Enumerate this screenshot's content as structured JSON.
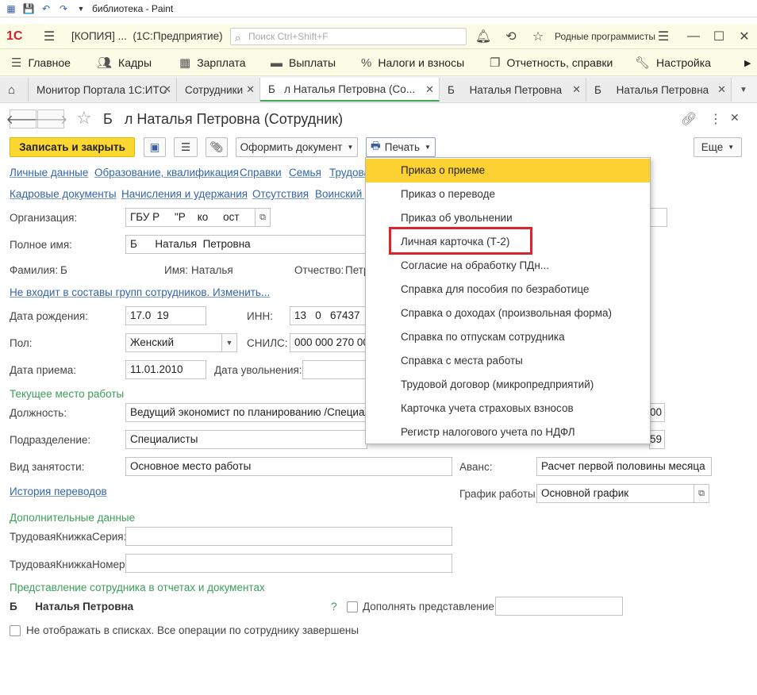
{
  "paint": {
    "title": "библиотека - Paint"
  },
  "top_bar": {
    "app_title": "[КОПИЯ] ...  (1С:Предприятие)",
    "search_placeholder": "Поиск Ctrl+Shift+F",
    "user": "Родные программисты"
  },
  "main_menu": {
    "items": [
      {
        "label": "Главное",
        "icon": "menu-icon"
      },
      {
        "label": "Кадры",
        "icon": "people-icon"
      },
      {
        "label": "Зарплата",
        "icon": "calculator-icon"
      },
      {
        "label": "Выплаты",
        "icon": "wallet-icon"
      },
      {
        "label": "Налоги и взносы",
        "icon": "percent-icon"
      },
      {
        "label": "Отчетность, справки",
        "icon": "report-icon"
      },
      {
        "label": "Настройка",
        "icon": "wrench-icon"
      }
    ]
  },
  "tabs": [
    {
      "label": "Монитор Портала 1С:ИТС"
    },
    {
      "label": "Сотрудники"
    },
    {
      "label": "Б   л Наталья Петровна (Со..."
    },
    {
      "label": "Б     Наталья Петровна"
    },
    {
      "label": "Б     Наталья Петровна"
    }
  ],
  "form": {
    "title": "Б   л Наталья Петровна (Сотрудник)",
    "toolbar": {
      "save_close": "Записать и закрыть",
      "create_doc": "Оформить документ",
      "print": "Печать",
      "more": "Еще"
    },
    "links_row1": [
      "Личные данные",
      "Образование, квалификация",
      "Справки",
      "Семья",
      "Трудова"
    ],
    "links_row2": [
      "Кадровые документы",
      "Начисления и удержания",
      "Отсутствия",
      "Воинский у"
    ],
    "labels": {
      "org": "Организация:",
      "fullname": "Полное имя:",
      "surname": "Фамилия:",
      "name": "Имя:",
      "patronymic": "Отчество:",
      "groups_link": "Не входит в составы групп сотрудников. Изменить...",
      "birth": "Дата рождения:",
      "inn": "ИНН:",
      "sex": "Пол:",
      "snils": "СНИЛС:",
      "hire": "Дата приема:",
      "fire": "Дата увольнения:",
      "current_work": "Текущее место работы",
      "position": "Должность:",
      "department": "Подразделение:",
      "employment": "Вид занятости:",
      "advance": "Аванс:",
      "history_link": "История переводов",
      "schedule": "График работы:",
      "extra": "Дополнительные данные",
      "book_series": "ТрудоваяКнижкаСерия:",
      "book_number": "ТрудоваяКнижкаНомер:",
      "representation": "Представление сотрудника в отчетах и документах",
      "complement": "Дополнять представление",
      "hide": "Не отображать в списках. Все операции по сотруднику завершены",
      "help": "?"
    },
    "values": {
      "org": "ГБУ Р     \"Р    ко     ост",
      "fullname": "Б      Наталья  Петровна",
      "surname": "Б",
      "name": "Наталья",
      "patronymic": "Петр",
      "birth": "17.0  19",
      "inn": "13   0   67437",
      "sex": "Женский",
      "snils": "000 000 270 00",
      "hire": "11.01.2010",
      "position": "Ведущий экономист по планированию /Специали",
      "department": "Специалисты",
      "employment": "Основное место работы",
      "advance": "Расчет первой половины месяца",
      "schedule": "Основной график",
      "right1": "00",
      "right2": "59",
      "rep_name": "Б      Наталья Петровна"
    }
  },
  "print_menu": {
    "items": [
      "Приказ о приеме",
      "Приказ о переводе",
      "Приказ об увольнении",
      "Личная карточка (Т-2)",
      "Согласие на обработку ПДн...",
      "Справка для пособия по безработице",
      "Справка о доходах (произвольная форма)",
      "Справка по отпускам сотрудника",
      "Справка с места работы",
      "Трудовой договор (микропредприятий)",
      "Карточка учета страховых взносов",
      "Регистр налогового учета по НДФЛ"
    ],
    "highlighted_index": 0,
    "marked_index": 3
  },
  "colors": {
    "accent_yellow": "#fcd732",
    "link_blue": "#3366a8",
    "section_green": "#3b9e56",
    "mark_red": "#d8262f"
  }
}
